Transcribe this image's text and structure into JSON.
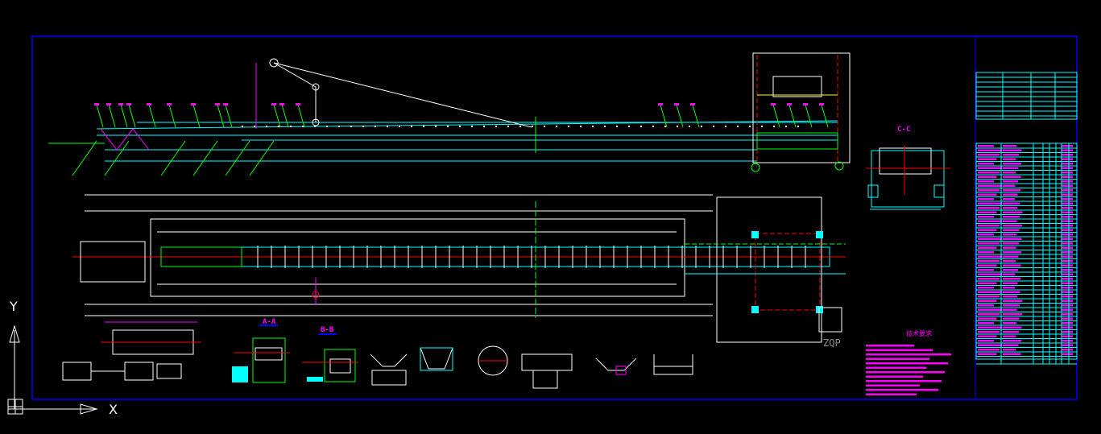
{
  "colors": {
    "background": "#000000",
    "frame": "#0000ff",
    "structure": "#00ffff",
    "dimension": "#ff00ff",
    "centerline": "#ff0000",
    "leader": "#00ff00",
    "outline": "#ffffff"
  },
  "sections": {
    "a": "A-A",
    "b": "B-B",
    "c": "C-C"
  },
  "notes": {
    "title": "技术要求"
  },
  "stamp": "ZQP",
  "ucs": {
    "x_axis": "X",
    "y_axis": "Y"
  }
}
